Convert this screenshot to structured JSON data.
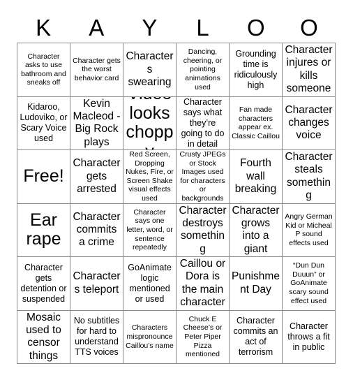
{
  "card": {
    "header_letters": [
      "K",
      "A",
      "Y",
      "L",
      "O",
      "O"
    ],
    "rows": [
      [
        {
          "text": "Character asks to use bathroom and sneaks off",
          "size": "sm"
        },
        {
          "text": "Character gets the worst behavior card",
          "size": "sm"
        },
        {
          "text": "Characters swearing",
          "size": "lg"
        },
        {
          "text": "Dancing, cheering, or pointing animations used",
          "size": "sm"
        },
        {
          "text": "Grounding time is ridiculously high",
          "size": "md"
        },
        {
          "text": "Character injures or kills someone",
          "size": "lg"
        }
      ],
      [
        {
          "text": "Kidaroo, Ludoviko, or Scary Voice used",
          "size": "md"
        },
        {
          "text": "Kevin Macleod - Big Rock plays",
          "size": "lg"
        },
        {
          "text": "Video looks choppy",
          "size": "xl"
        },
        {
          "text": "Character says what they’re going to do in detail",
          "size": "md"
        },
        {
          "text": "Fan made characters appear ex. Classic Caillou",
          "size": "sm"
        },
        {
          "text": "Character changes voice",
          "size": "lg"
        }
      ],
      [
        {
          "text": "Free!",
          "size": "xl"
        },
        {
          "text": "Character gets arrested",
          "size": "lg"
        },
        {
          "text": "Red Screen, Dropping Nukes, Fire, or Screen Shake visual effects used",
          "size": "sm"
        },
        {
          "text": "Crusty JPEGs or Stock Images used for characters or backgrounds",
          "size": "sm"
        },
        {
          "text": "Fourth wall breaking",
          "size": "lg"
        },
        {
          "text": "Character steals something",
          "size": "lg"
        }
      ],
      [
        {
          "text": "Ear rape",
          "size": "xl"
        },
        {
          "text": "Character commits a crime",
          "size": "lg"
        },
        {
          "text": "Character says one letter, word, or sentence repeatedly",
          "size": "sm"
        },
        {
          "text": "Character destroys something",
          "size": "lg"
        },
        {
          "text": "Character grows into a giant",
          "size": "lg"
        },
        {
          "text": "Angry German Kid or Micheal P sound effects used",
          "size": "sm"
        }
      ],
      [
        {
          "text": "Character gets detention or suspended",
          "size": "md"
        },
        {
          "text": "Characters teleport",
          "size": "lg"
        },
        {
          "text": "GoAnimate logic mentioned or used",
          "size": "md"
        },
        {
          "text": "Caillou or Dora is the main character",
          "size": "lg"
        },
        {
          "text": "Punishment Day",
          "size": "lg"
        },
        {
          "text": "“Dun Dun Duuun” or GoAnimate scary sound effect used",
          "size": "sm"
        }
      ],
      [
        {
          "text": "Mosaic used to censor things",
          "size": "lg"
        },
        {
          "text": "No subtitles for hard to understand TTS voices",
          "size": "md"
        },
        {
          "text": "Characters mispronounce Caillou’s name",
          "size": "sm"
        },
        {
          "text": "Chuck E Cheese’s or Peter Piper Pizza mentioned",
          "size": "sm"
        },
        {
          "text": "Character commits an act of terrorism",
          "size": "md"
        },
        {
          "text": "Character throws a fit in public",
          "size": "md"
        }
      ]
    ]
  },
  "colors": {
    "background": "#ffffff",
    "grid_line": "#8a8a8a",
    "text": "#000000"
  }
}
